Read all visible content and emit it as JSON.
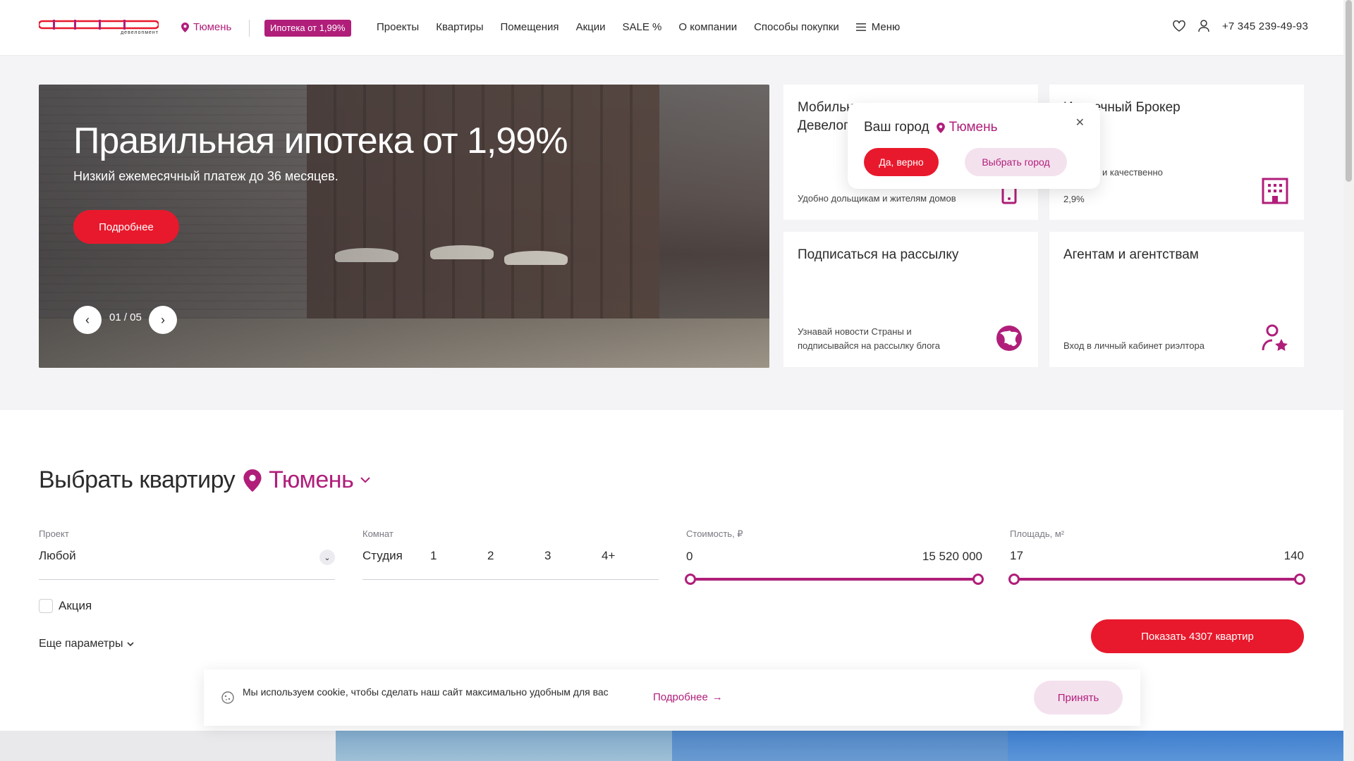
{
  "header": {
    "logo_sub": "девелопмент",
    "city": "Тюмень",
    "promo": "Ипотека от 1,99%",
    "nav": [
      "Проекты",
      "Квартиры",
      "Помещения",
      "Акции",
      "SALE %",
      "О компании",
      "Способы покупки"
    ],
    "menu_label": "Меню",
    "phone": "+7 345 239-49-93"
  },
  "hero": {
    "title": "Правильная ипотека от 1,99%",
    "lead": "Низкий ежемесячный платеж до 36 месяцев.",
    "button": "Подробнее",
    "counter": "01 / 05"
  },
  "cards": [
    {
      "title": "Мобильное приложение\nДевелопмент",
      "desc": "Удобно дольщикам и жителям домов"
    },
    {
      "title": "Ипотечный Брокер",
      "desc": "Выгодно и качественно\n2,9%"
    },
    {
      "title": "Подписаться на рассылку",
      "desc": "Узнавай новости Страны и подписывайся на рассылку блога"
    },
    {
      "title": "Агентам и агентствам",
      "desc": "Вход в личный кабинет риэлтора"
    }
  ],
  "city_popup": {
    "question": "Ваш город",
    "city": "Тюмень",
    "yes": "Да, верно",
    "choose": "Выбрать город"
  },
  "filter": {
    "heading": "Выбрать квартиру",
    "city": "Тюмень",
    "project_label": "Проект",
    "project_value": "Любой",
    "rooms_label": "Комнат",
    "rooms": [
      "Студия",
      "1",
      "2",
      "3",
      "4+"
    ],
    "price_label": "Стоимость, ₽",
    "price_min": "0",
    "price_max": "15 520 000",
    "area_label": "Площадь, м²",
    "area_min": "17",
    "area_max": "140",
    "promo_check": "Акция",
    "more_params": "Еще параметры",
    "show_button": "Показать 4307 квартир"
  },
  "cookie": {
    "text": "Мы используем cookie, чтобы сделать наш сайт максимально удобным для вас",
    "link": "Подробнее",
    "accept": "Принять"
  },
  "colors": {
    "brand": "#b01e7a",
    "accent_red": "#e8192c",
    "light_pink": "#f4e1ee"
  }
}
